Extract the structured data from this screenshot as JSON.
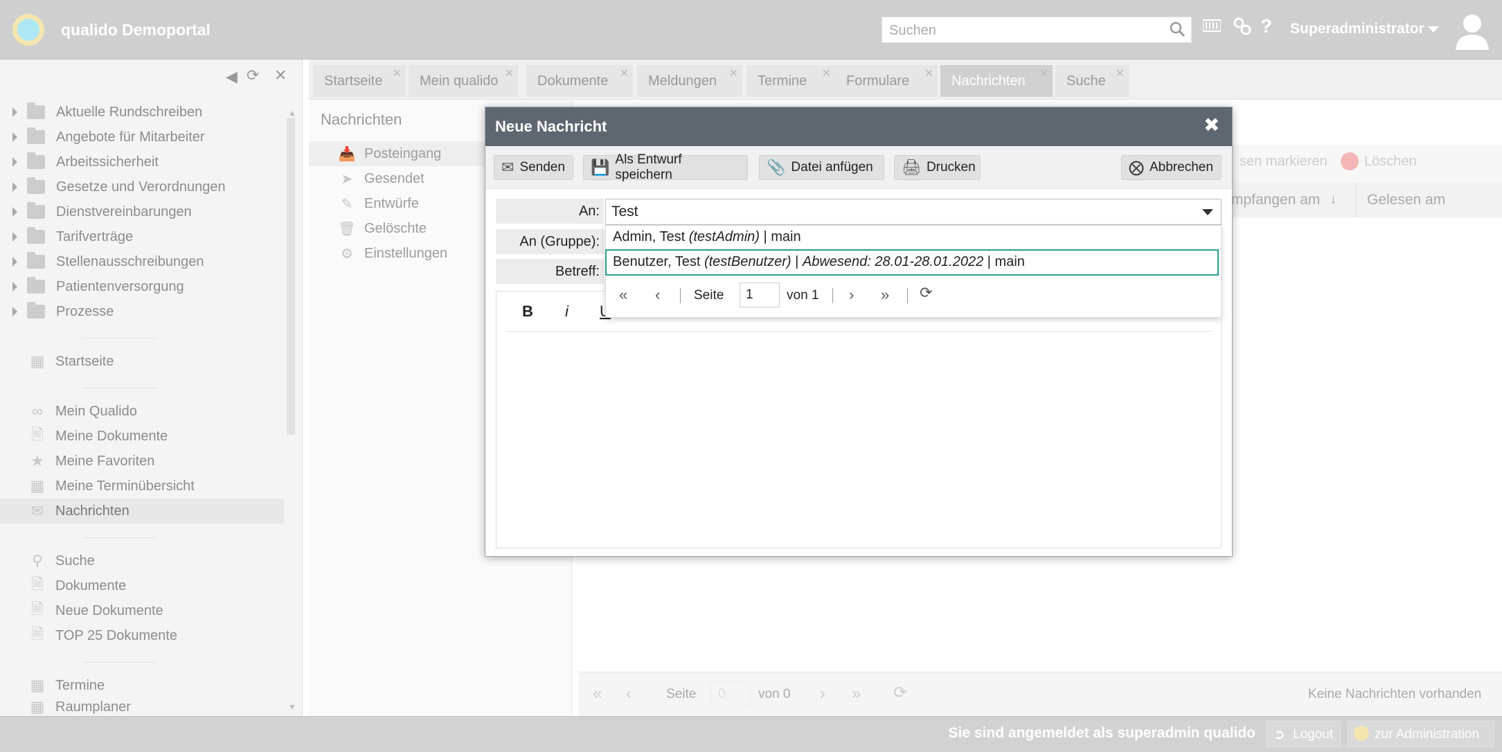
{
  "header": {
    "portal_name": "qualido Demoportal",
    "search_placeholder": "Suchen",
    "user_name": "Superadministrator"
  },
  "sidebar": {
    "folders": [
      "Aktuelle Rundschreiben",
      "Angebote für Mitarbeiter",
      "Arbeitssicherheit",
      "Gesetze und Verordnungen",
      "Dienstvereinbarungen",
      "Tarifverträge",
      "Stellenausschreibungen",
      "Patientenversorgung",
      "Prozesse"
    ],
    "nav": {
      "startseite": "Startseite",
      "mein_qualido": "Mein Qualido",
      "meine_dokumente": "Meine Dokumente",
      "meine_favoriten": "Meine Favoriten",
      "meine_termine": "Meine Terminübersicht",
      "nachrichten": "Nachrichten",
      "suche": "Suche",
      "dokumente": "Dokumente",
      "neue_dokumente": "Neue Dokumente",
      "top25": "TOP 25 Dokumente",
      "termine": "Termine",
      "raumplaner": "Raumplaner"
    }
  },
  "tabs": [
    "Startseite",
    "Mein qualido",
    "Dokumente",
    "Meldungen",
    "Termine",
    "Formulare",
    "Nachrichten",
    "Suche"
  ],
  "messages": {
    "title": "Nachrichten",
    "folders": [
      "Posteingang",
      "Gesendet",
      "Entwürfe",
      "Gelöschte",
      "Einstellungen"
    ],
    "toolbar": {
      "mark_read": "sen markieren",
      "delete": "Löschen"
    },
    "columns": {
      "received": "mpfangen am",
      "read": "Gelesen am"
    },
    "pager": {
      "page_label": "Seite",
      "page_value": "0",
      "of_label": "von 0",
      "empty_text": "Keine Nachrichten vorhanden"
    }
  },
  "footer": {
    "logged_in_prefix": "Sie sind angemeldet als",
    "logged_in_user": "superadmin qualido",
    "logout": "Logout",
    "admin": "zur Administration"
  },
  "dialog": {
    "title": "Neue Nachricht",
    "buttons": {
      "send": "Senden",
      "save_draft": "Als Entwurf speichern",
      "attach": "Datei anfügen",
      "print": "Drucken",
      "cancel": "Abbrechen"
    },
    "fields": {
      "to_label": "An:",
      "to_value": "Test",
      "group_label": "An (Gruppe):",
      "subject_label": "Betreff:"
    },
    "dropdown": {
      "item1_name": "Admin, Test",
      "item1_login": "(testAdmin)",
      "item1_suffix": "| main",
      "item2_name": "Benutzer, Test",
      "item2_login": "(testBenutzer)",
      "item2_sep": "|",
      "item2_absent": "Abwesend: 28.01-28.01.2022",
      "item2_suffix": "| main",
      "page_label": "Seite",
      "page_value": "1",
      "of_label": "von 1"
    },
    "editor_tools": {
      "bold": "B",
      "italic": "i"
    }
  }
}
